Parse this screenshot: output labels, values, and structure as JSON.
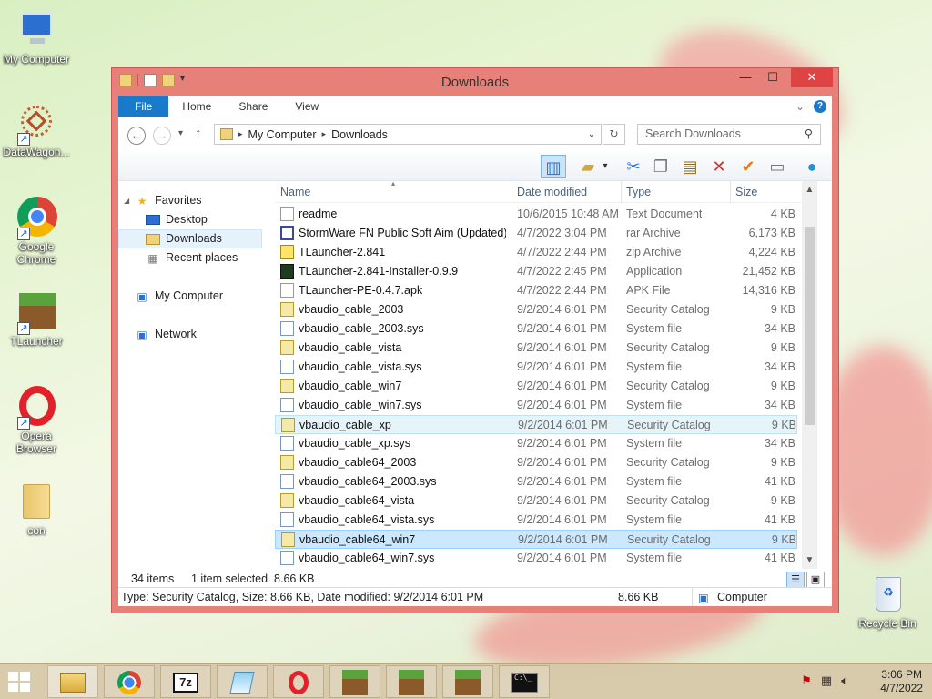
{
  "desktop": {
    "icons": [
      {
        "label": "My Computer",
        "icon": "computer-icon"
      },
      {
        "label": "DataWagon...",
        "icon": "datawagon-icon"
      },
      {
        "label": "Google Chrome",
        "icon": "chrome-icon"
      },
      {
        "label": "TLauncher",
        "icon": "tlauncher-icon"
      },
      {
        "label": "Opera Browser",
        "icon": "opera-icon"
      },
      {
        "label": "con",
        "icon": "folder-icon"
      },
      {
        "label": "Recycle Bin",
        "icon": "recycle-bin-icon"
      }
    ]
  },
  "window": {
    "title": "Downloads",
    "minimize": "—",
    "maximize": "☐",
    "close": "✕",
    "ribbon_tabs": [
      "File",
      "Home",
      "Share",
      "View"
    ],
    "address": {
      "root": "My Computer",
      "current": "Downloads"
    },
    "search_placeholder": "Search Downloads",
    "nav": {
      "favorites": "Favorites",
      "desktop": "Desktop",
      "downloads": "Downloads",
      "recent": "Recent places",
      "my_computer": "My Computer",
      "network": "Network"
    },
    "columns": {
      "name": "Name",
      "date": "Date modified",
      "type": "Type",
      "size": "Size"
    },
    "files": [
      {
        "name": "readme",
        "date": "10/6/2015 10:48 AM",
        "type": "Text Document",
        "size": "4 KB",
        "icon": "text-doc-icon"
      },
      {
        "name": "StormWare FN Public Soft Aim (Updated)",
        "date": "4/7/2022 3:04 PM",
        "type": "rar Archive",
        "size": "6,173 KB",
        "icon": "rar-icon"
      },
      {
        "name": "TLauncher-2.841",
        "date": "4/7/2022 2:44 PM",
        "type": "zip Archive",
        "size": "4,224 KB",
        "icon": "zip-icon"
      },
      {
        "name": "TLauncher-2.841-Installer-0.9.9",
        "date": "4/7/2022 2:45 PM",
        "type": "Application",
        "size": "21,452 KB",
        "icon": "app-icon"
      },
      {
        "name": "TLauncher-PE-0.4.7.apk",
        "date": "4/7/2022 2:44 PM",
        "type": "APK File",
        "size": "14,316 KB",
        "icon": "file-icon"
      },
      {
        "name": "vbaudio_cable_2003",
        "date": "9/2/2014 6:01 PM",
        "type": "Security Catalog",
        "size": "9 KB",
        "icon": "catalog-icon"
      },
      {
        "name": "vbaudio_cable_2003.sys",
        "date": "9/2/2014 6:01 PM",
        "type": "System file",
        "size": "34 KB",
        "icon": "sys-icon"
      },
      {
        "name": "vbaudio_cable_vista",
        "date": "9/2/2014 6:01 PM",
        "type": "Security Catalog",
        "size": "9 KB",
        "icon": "catalog-icon"
      },
      {
        "name": "vbaudio_cable_vista.sys",
        "date": "9/2/2014 6:01 PM",
        "type": "System file",
        "size": "34 KB",
        "icon": "sys-icon"
      },
      {
        "name": "vbaudio_cable_win7",
        "date": "9/2/2014 6:01 PM",
        "type": "Security Catalog",
        "size": "9 KB",
        "icon": "catalog-icon"
      },
      {
        "name": "vbaudio_cable_win7.sys",
        "date": "9/2/2014 6:01 PM",
        "type": "System file",
        "size": "34 KB",
        "icon": "sys-icon"
      },
      {
        "name": "vbaudio_cable_xp",
        "date": "9/2/2014 6:01 PM",
        "type": "Security Catalog",
        "size": "9 KB",
        "icon": "catalog-icon"
      },
      {
        "name": "vbaudio_cable_xp.sys",
        "date": "9/2/2014 6:01 PM",
        "type": "System file",
        "size": "34 KB",
        "icon": "sys-icon"
      },
      {
        "name": "vbaudio_cable64_2003",
        "date": "9/2/2014 6:01 PM",
        "type": "Security Catalog",
        "size": "9 KB",
        "icon": "catalog-icon"
      },
      {
        "name": "vbaudio_cable64_2003.sys",
        "date": "9/2/2014 6:01 PM",
        "type": "System file",
        "size": "41 KB",
        "icon": "sys-icon"
      },
      {
        "name": "vbaudio_cable64_vista",
        "date": "9/2/2014 6:01 PM",
        "type": "Security Catalog",
        "size": "9 KB",
        "icon": "catalog-icon"
      },
      {
        "name": "vbaudio_cable64_vista.sys",
        "date": "9/2/2014 6:01 PM",
        "type": "System file",
        "size": "41 KB",
        "icon": "sys-icon"
      },
      {
        "name": "vbaudio_cable64_win7",
        "date": "9/2/2014 6:01 PM",
        "type": "Security Catalog",
        "size": "9 KB",
        "icon": "catalog-icon"
      },
      {
        "name": "vbaudio_cable64_win7.sys",
        "date": "9/2/2014 6:01 PM",
        "type": "System file",
        "size": "41 KB",
        "icon": "sys-icon"
      }
    ],
    "selected_file": "vbaudio_cable64_win7",
    "hover_file": "vbaudio_cable_xp",
    "item_count": "34 items",
    "selection_info": "1 item selected  8.66 KB",
    "details_bar": "Type: Security Catalog, Size: 8.66 KB, Date modified: 9/2/2014 6:01 PM",
    "details_size": "8.66 KB",
    "details_location": "Computer"
  },
  "taskbar": {
    "apps": [
      "start-icon",
      "file-explorer-icon",
      "chrome-icon",
      "7zip-icon",
      "notepad-icon",
      "opera-icon",
      "minecraft-icon",
      "minecraft-icon",
      "minecraft-icon",
      "cmd-icon"
    ],
    "time": "3:06 PM",
    "date": "4/7/2022"
  },
  "colors": {
    "window_frame": "#e8807a",
    "close_button": "#e04343",
    "file_tab": "#1979ca",
    "selection": "#cce8ff"
  }
}
